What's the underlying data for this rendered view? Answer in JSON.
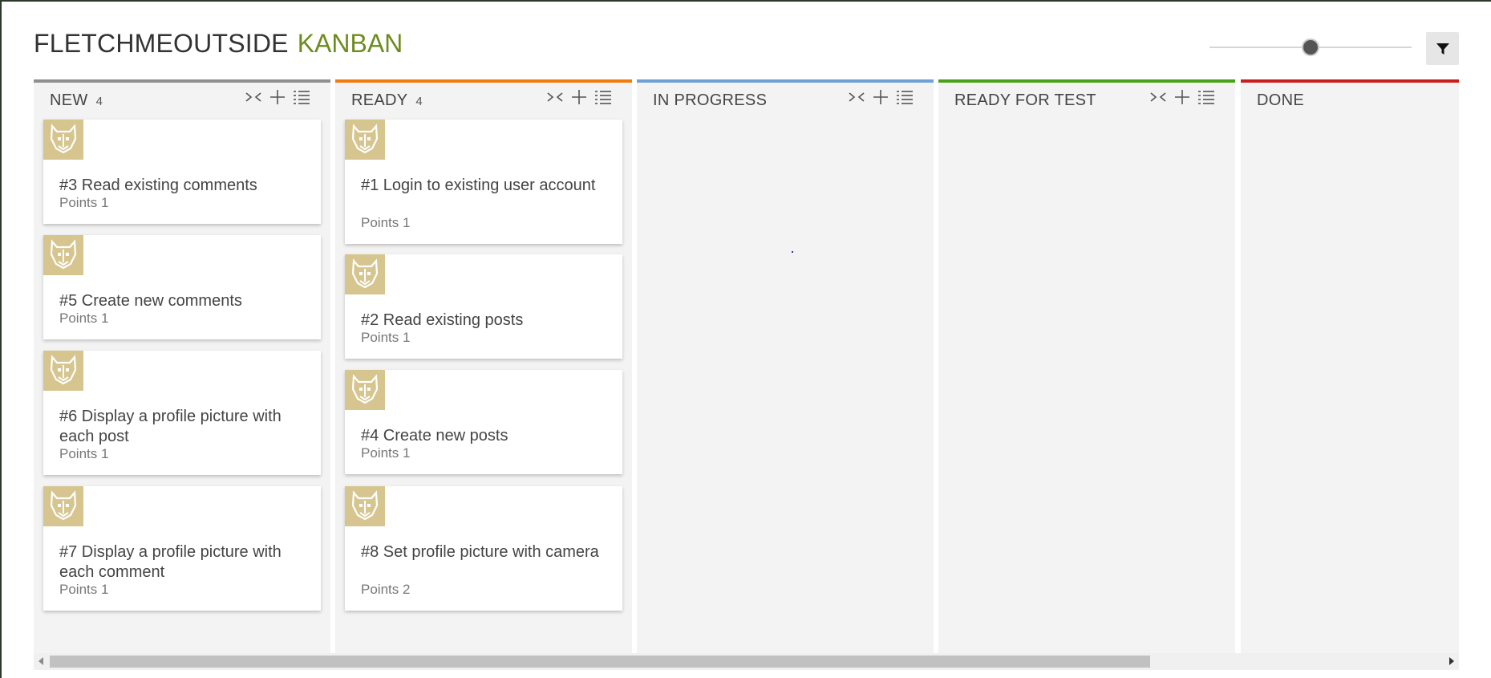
{
  "app": {
    "title_main": "FLETCHMEOUTSIDE",
    "title_accent": "KANBAN"
  },
  "colors": {
    "title_accent": "#6d8c1e",
    "avatar_bg": "#d6c58f",
    "column_bg": "#f3f3f3"
  },
  "toolbar": {
    "zoom_level": 0.5,
    "filter_icon": "filter-icon"
  },
  "columns": [
    {
      "title": "NEW",
      "count": "4",
      "accent": "#8f8f8f",
      "cards": [
        {
          "title": "#3 Read existing comments",
          "points": "Points 1"
        },
        {
          "title": "#5 Create new comments",
          "points": "Points 1"
        },
        {
          "title": "#6 Display a profile picture with each post",
          "points": "Points 1"
        },
        {
          "title": "#7 Display a profile picture with each comment",
          "points": "Points 1"
        }
      ]
    },
    {
      "title": "READY",
      "count": "4",
      "accent": "#f07c0d",
      "cards": [
        {
          "title": "#1 Login to existing user account",
          "points": "Points 1"
        },
        {
          "title": "#2 Read existing posts",
          "points": "Points 1"
        },
        {
          "title": "#4 Create new posts",
          "points": "Points 1"
        },
        {
          "title": "#8 Set profile picture with camera",
          "points": "Points 2"
        }
      ]
    },
    {
      "title": "IN PROGRESS",
      "count": "",
      "accent": "#6fa1d6",
      "cards": []
    },
    {
      "title": "READY FOR TEST",
      "count": "",
      "accent": "#4aa017",
      "cards": []
    },
    {
      "title": "DONE",
      "count": "",
      "accent": "#c81e1e",
      "cards": []
    }
  ],
  "icons": {
    "collapse": "collapse-icon",
    "add": "add-icon",
    "list": "list-icon",
    "avatar": "user-avatar-icon"
  }
}
